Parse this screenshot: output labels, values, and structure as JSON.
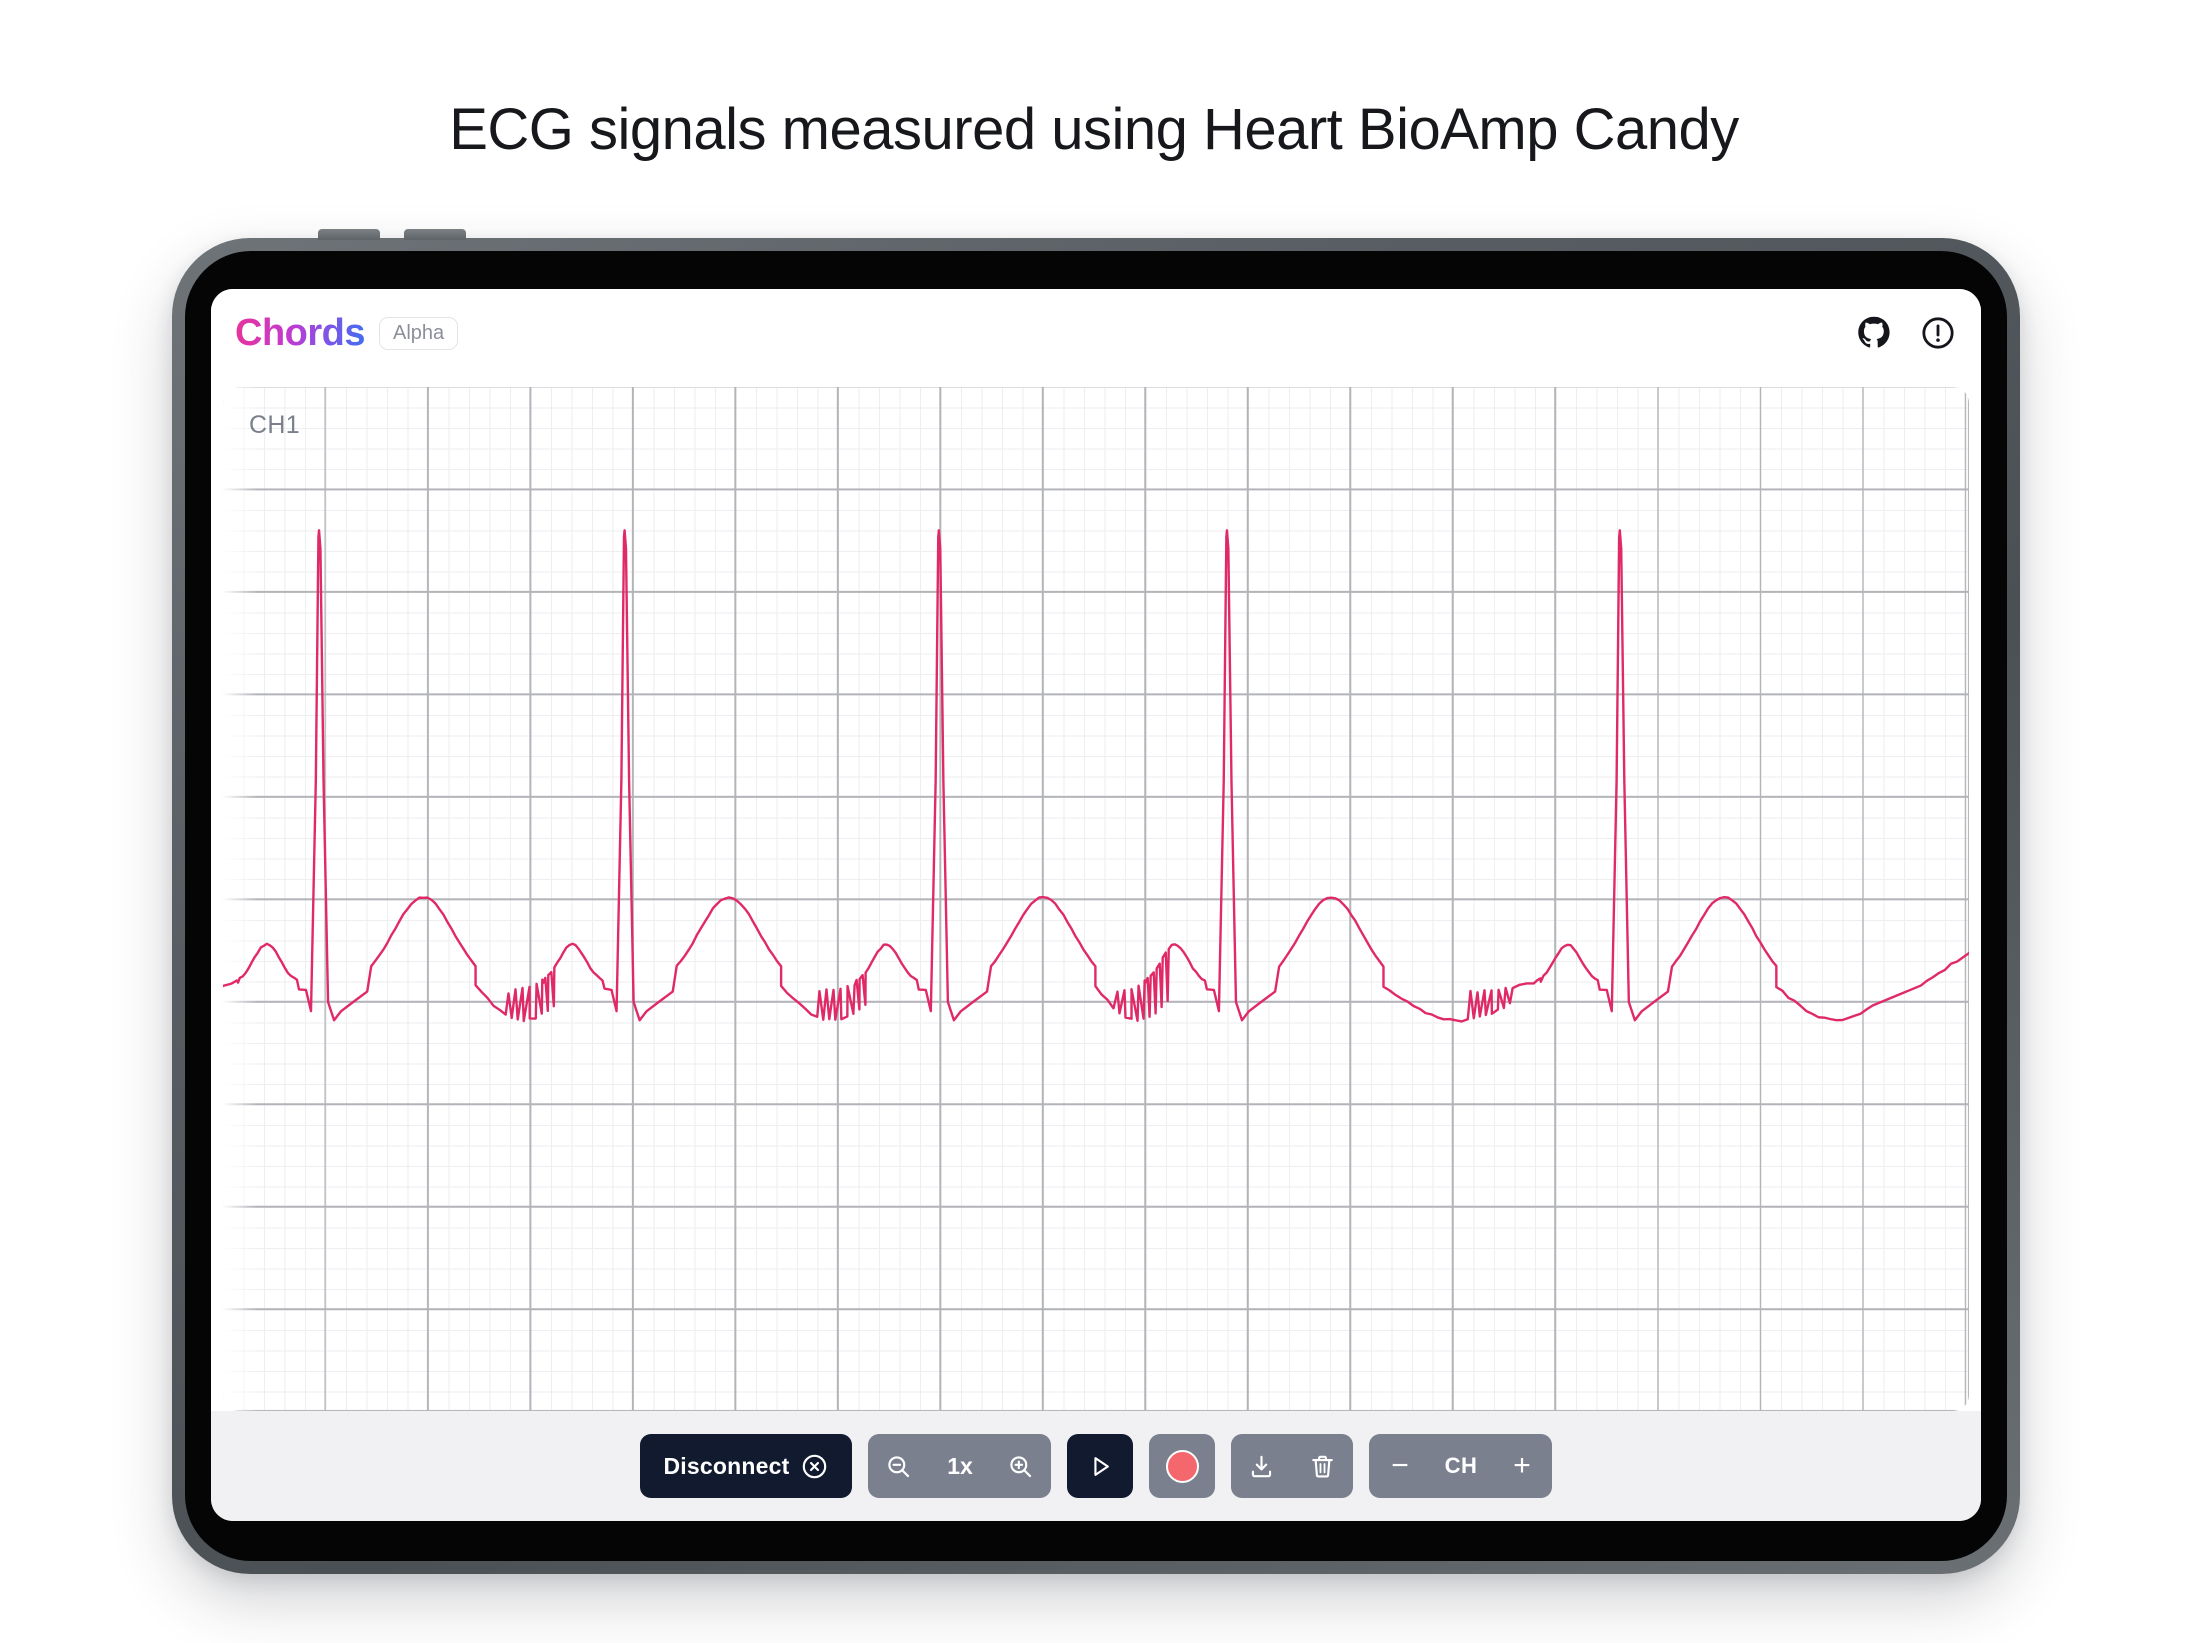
{
  "page": {
    "title": "ECG signals measured using Heart BioAmp Candy",
    "background": "#ffffff"
  },
  "device": {
    "type": "tablet",
    "frame_color": "#5c6266",
    "screen_color": "#050505"
  },
  "app": {
    "header": {
      "brand": "Chords",
      "brand_gradient_from": "#e8349a",
      "brand_gradient_to": "#3f6ff0",
      "badge": "Alpha",
      "actions": [
        {
          "name": "github-icon",
          "label": "GitHub"
        },
        {
          "name": "info-icon",
          "label": "Info"
        }
      ]
    },
    "chart": {
      "channel_label": "CH1",
      "grid_minor_color": "#edeef1",
      "grid_major_color": "#b3b4b8",
      "trace_color": "#e02a68",
      "background": "#ffffff"
    },
    "toolbar": {
      "disconnect_label": "Disconnect",
      "zoom_out_label": "Zoom out",
      "zoom_level_label": "1x",
      "zoom_in_label": "Zoom in",
      "play_label": "Play",
      "record_label": "Record",
      "download_label": "Download",
      "delete_label": "Delete",
      "channel_minus_label": "−",
      "channel_label": "CH",
      "channel_plus_label": "+",
      "dark_color": "#111a2e",
      "gray_color": "#7b808f",
      "record_color": "#f4676c"
    }
  },
  "chart_data": {
    "type": "line",
    "title": "ECG signals measured using Heart BioAmp Candy",
    "xlabel": "",
    "ylabel": "",
    "series_name": "CH1",
    "trace_color": "#e02a68",
    "grid": true,
    "ylim": [
      0,
      1
    ],
    "xlim": [
      0,
      1
    ],
    "beats": 5,
    "baseline_y": 0.585,
    "r_peak_y": 0.14,
    "beat_x_positions": [
      0.055,
      0.23,
      0.41,
      0.575,
      0.8
    ],
    "description": "Five ECG PQRST complexes on a medical grid; sharp R spikes reaching near the top of the trace band, broad T waves after each beat, small P waves before each QRS."
  }
}
